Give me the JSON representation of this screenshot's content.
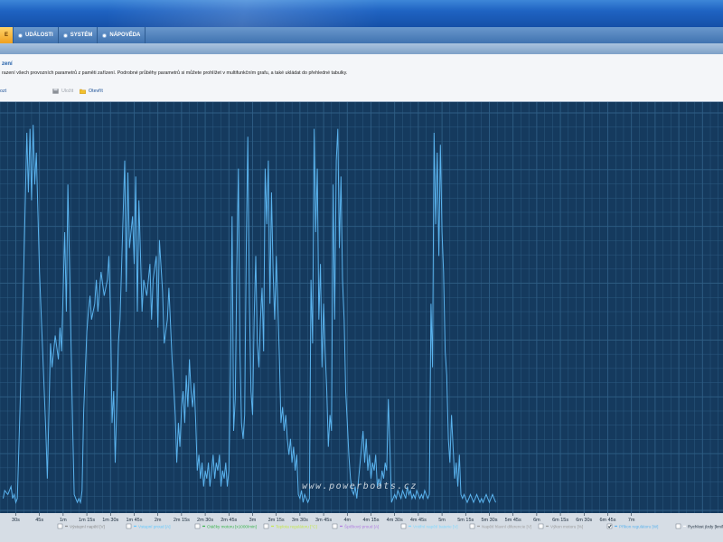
{
  "menu": {
    "items": [
      {
        "label": "E",
        "active": true
      },
      {
        "label": "UDÁLOSTI",
        "active": false
      },
      {
        "label": "SYSTÉM",
        "active": false
      },
      {
        "label": "NÁPOVĚDA",
        "active": false
      }
    ]
  },
  "info": {
    "title": "zení",
    "description": "razení všech provozních parametrů z paměti zařízení. Podrobné průběhy parametrů si můžete prohlížet v multifunkčním grafu, a také ukládat do přehledné tabulky.",
    "toolbar": {
      "left_label": "ozt",
      "save_label": "Uložit",
      "open_label": "Otevřít"
    }
  },
  "watermark": "www.powerboats.cz",
  "colors": {
    "chart_bg": "#153a5e",
    "grid": "#2f5f86",
    "line": "#5ab3ee",
    "axis_text": "#e8eef6"
  },
  "chart_data": {
    "type": "line",
    "x_unit": "s",
    "xlim": [
      20,
      478
    ],
    "ylim": [
      0,
      100
    ],
    "grid": true,
    "x_ticks": [
      {
        "label": "30s",
        "x": 30
      },
      {
        "label": "45s",
        "x": 45
      },
      {
        "label": "1m",
        "x": 60
      },
      {
        "label": "1m 15s",
        "x": 75
      },
      {
        "label": "1m 30s",
        "x": 90
      },
      {
        "label": "1m 45s",
        "x": 105
      },
      {
        "label": "2m",
        "x": 120
      },
      {
        "label": "2m 15s",
        "x": 135
      },
      {
        "label": "2m 30s",
        "x": 150
      },
      {
        "label": "2m 45s",
        "x": 165
      },
      {
        "label": "3m",
        "x": 180
      },
      {
        "label": "3m 15s",
        "x": 195
      },
      {
        "label": "3m 30s",
        "x": 210
      },
      {
        "label": "3m 45s",
        "x": 225
      },
      {
        "label": "4m",
        "x": 240
      },
      {
        "label": "4m 15s",
        "x": 255
      },
      {
        "label": "4m 30s",
        "x": 270
      },
      {
        "label": "4m 45s",
        "x": 285
      },
      {
        "label": "5m",
        "x": 300
      },
      {
        "label": "5m 15s",
        "x": 315
      },
      {
        "label": "5m 30s",
        "x": 330
      },
      {
        "label": "5m 45s",
        "x": 345
      },
      {
        "label": "6m",
        "x": 360
      },
      {
        "label": "6m 15s",
        "x": 375
      },
      {
        "label": "6m 30s",
        "x": 390
      },
      {
        "label": "6m 45s",
        "x": 405
      },
      {
        "label": "7m",
        "x": 420
      }
    ],
    "legend": [
      {
        "name": "Výstupní napětí [V]",
        "color": "#8a8a8a",
        "checked": false
      },
      {
        "name": "Vstupní proud [A]",
        "color": "#5ec8ff",
        "checked": false
      },
      {
        "name": "Otáčky motoru [x1000/min]",
        "color": "#39b54a",
        "checked": false
      },
      {
        "name": "Teplota regulátoru [°C]",
        "color": "#c4e84a",
        "checked": false
      },
      {
        "name": "Špičkový proud [A]",
        "color": "#b07ae0",
        "checked": false
      },
      {
        "name": "Vnitřní napětí baterie [V]",
        "color": "#7fd8ff",
        "checked": false
      },
      {
        "name": "Napětí hlavní diferencie [V]",
        "color": "#a0a0a0",
        "checked": false
      },
      {
        "name": "Výkon motoru [%]",
        "color": "#9a9a9a",
        "checked": false
      },
      {
        "name": "Příkon regulátoru [W]",
        "color": "#5ab3ee",
        "checked": true
      },
      {
        "name": "Rychlost jízdy [km/h]",
        "color": "#ffffff",
        "checked": false
      }
    ],
    "series": [
      {
        "values": [
          [
            22,
            3
          ],
          [
            23,
            5
          ],
          [
            25,
            4
          ],
          [
            27,
            6
          ],
          [
            28,
            3
          ],
          [
            29,
            4
          ],
          [
            30,
            2
          ],
          [
            31,
            3
          ],
          [
            33,
            30
          ],
          [
            35,
            60
          ],
          [
            37,
            95
          ],
          [
            38,
            80
          ],
          [
            39,
            96
          ],
          [
            40,
            78
          ],
          [
            41,
            97
          ],
          [
            42,
            82
          ],
          [
            43,
            90
          ],
          [
            45,
            60
          ],
          [
            47,
            40
          ],
          [
            49,
            20
          ],
          [
            50,
            8
          ],
          [
            52,
            42
          ],
          [
            53,
            36
          ],
          [
            55,
            44
          ],
          [
            57,
            38
          ],
          [
            58,
            46
          ],
          [
            59,
            40
          ],
          [
            61,
            70
          ],
          [
            62,
            50
          ],
          [
            63,
            82
          ],
          [
            64,
            62
          ],
          [
            65,
            42
          ],
          [
            66,
            22
          ],
          [
            67,
            4
          ],
          [
            68,
            3
          ],
          [
            69,
            2
          ],
          [
            70,
            3
          ],
          [
            71,
            2
          ],
          [
            72,
            5
          ],
          [
            73,
            25
          ],
          [
            75,
            45
          ],
          [
            76,
            50
          ],
          [
            77,
            54
          ],
          [
            78,
            48
          ],
          [
            80,
            52
          ],
          [
            81,
            58
          ],
          [
            82,
            50
          ],
          [
            84,
            60
          ],
          [
            86,
            54
          ],
          [
            88,
            58
          ],
          [
            89,
            64
          ],
          [
            90,
            50
          ],
          [
            91,
            22
          ],
          [
            92,
            30
          ],
          [
            93,
            12
          ],
          [
            95,
            42
          ],
          [
            96,
            48
          ],
          [
            98,
            74
          ],
          [
            99,
            88
          ],
          [
            100,
            55
          ],
          [
            101,
            85
          ],
          [
            102,
            66
          ],
          [
            104,
            74
          ],
          [
            105,
            62
          ],
          [
            106,
            84
          ],
          [
            107,
            50
          ],
          [
            108,
            78
          ],
          [
            109,
            64
          ],
          [
            110,
            50
          ],
          [
            111,
            58
          ],
          [
            113,
            54
          ],
          [
            115,
            62
          ],
          [
            116,
            48
          ],
          [
            117,
            58
          ],
          [
            119,
            64
          ],
          [
            120,
            46
          ],
          [
            121,
            68
          ],
          [
            123,
            55
          ],
          [
            124,
            42
          ],
          [
            126,
            48
          ],
          [
            127,
            56
          ],
          [
            129,
            38
          ],
          [
            130,
            32
          ],
          [
            131,
            24
          ],
          [
            132,
            12
          ],
          [
            133,
            22
          ],
          [
            134,
            16
          ],
          [
            135,
            26
          ],
          [
            136,
            30
          ],
          [
            137,
            22
          ],
          [
            138,
            34
          ],
          [
            139,
            26
          ],
          [
            140,
            38
          ],
          [
            141,
            30
          ],
          [
            142,
            26
          ],
          [
            143,
            32
          ],
          [
            144,
            22
          ],
          [
            145,
            10
          ],
          [
            146,
            14
          ],
          [
            147,
            8
          ],
          [
            148,
            12
          ],
          [
            149,
            6
          ],
          [
            150,
            10
          ],
          [
            151,
            8
          ],
          [
            152,
            12
          ],
          [
            153,
            6
          ],
          [
            154,
            10
          ],
          [
            155,
            14
          ],
          [
            156,
            8
          ],
          [
            157,
            12
          ],
          [
            158,
            10
          ],
          [
            159,
            14
          ],
          [
            160,
            6
          ],
          [
            161,
            10
          ],
          [
            162,
            8
          ],
          [
            163,
            12
          ],
          [
            164,
            6
          ],
          [
            165,
            10
          ],
          [
            166,
            34
          ],
          [
            167,
            74
          ],
          [
            168,
            20
          ],
          [
            169,
            28
          ],
          [
            170,
            60
          ],
          [
            171,
            86
          ],
          [
            172,
            40
          ],
          [
            173,
            22
          ],
          [
            174,
            18
          ],
          [
            175,
            24
          ],
          [
            176,
            66
          ],
          [
            177,
            94
          ],
          [
            178,
            52
          ],
          [
            179,
            30
          ],
          [
            180,
            24
          ],
          [
            181,
            48
          ],
          [
            182,
            64
          ],
          [
            183,
            42
          ],
          [
            184,
            36
          ],
          [
            185,
            48
          ],
          [
            186,
            56
          ],
          [
            187,
            40
          ],
          [
            188,
            86
          ],
          [
            189,
            72
          ],
          [
            190,
            88
          ],
          [
            191,
            52
          ],
          [
            192,
            80
          ],
          [
            193,
            60
          ],
          [
            194,
            48
          ],
          [
            195,
            64
          ],
          [
            196,
            52
          ],
          [
            197,
            38
          ],
          [
            198,
            22
          ],
          [
            199,
            26
          ],
          [
            200,
            20
          ],
          [
            201,
            24
          ],
          [
            202,
            18
          ],
          [
            203,
            14
          ],
          [
            204,
            18
          ],
          [
            205,
            12
          ],
          [
            206,
            16
          ],
          [
            207,
            10
          ],
          [
            208,
            14
          ],
          [
            209,
            4
          ],
          [
            210,
            3
          ],
          [
            211,
            5
          ],
          [
            212,
            2
          ],
          [
            213,
            4
          ],
          [
            214,
            3
          ],
          [
            215,
            2
          ],
          [
            216,
            3
          ],
          [
            217,
            58
          ],
          [
            218,
            42
          ],
          [
            219,
            96
          ],
          [
            220,
            70
          ],
          [
            221,
            86
          ],
          [
            222,
            48
          ],
          [
            223,
            62
          ],
          [
            224,
            36
          ],
          [
            225,
            52
          ],
          [
            226,
            40
          ],
          [
            227,
            30
          ],
          [
            228,
            16
          ],
          [
            229,
            24
          ],
          [
            230,
            20
          ],
          [
            231,
            82
          ],
          [
            232,
            48
          ],
          [
            233,
            88
          ],
          [
            234,
            96
          ],
          [
            235,
            66
          ],
          [
            236,
            84
          ],
          [
            237,
            58
          ],
          [
            238,
            48
          ],
          [
            239,
            30
          ],
          [
            240,
            22
          ],
          [
            241,
            14
          ],
          [
            242,
            8
          ],
          [
            243,
            5
          ],
          [
            244,
            4
          ],
          [
            245,
            6
          ],
          [
            246,
            3
          ],
          [
            250,
            20
          ],
          [
            251,
            12
          ],
          [
            252,
            18
          ],
          [
            253,
            10
          ],
          [
            254,
            14
          ],
          [
            255,
            8
          ],
          [
            256,
            12
          ],
          [
            257,
            10
          ],
          [
            258,
            14
          ],
          [
            259,
            6
          ],
          [
            260,
            8
          ],
          [
            261,
            6
          ],
          [
            262,
            10
          ],
          [
            263,
            8
          ],
          [
            264,
            12
          ],
          [
            265,
            10
          ],
          [
            266,
            28
          ],
          [
            267,
            16
          ],
          [
            268,
            2
          ],
          [
            269,
            3
          ],
          [
            270,
            4
          ],
          [
            271,
            3
          ],
          [
            272,
            5
          ],
          [
            273,
            4
          ],
          [
            274,
            3
          ],
          [
            275,
            5
          ],
          [
            276,
            4
          ],
          [
            277,
            3
          ],
          [
            278,
            6
          ],
          [
            279,
            4
          ],
          [
            280,
            5
          ],
          [
            281,
            3
          ],
          [
            282,
            4
          ],
          [
            283,
            3
          ],
          [
            284,
            5
          ],
          [
            285,
            4
          ],
          [
            286,
            3
          ],
          [
            287,
            4
          ],
          [
            288,
            3
          ],
          [
            289,
            5
          ],
          [
            290,
            4
          ],
          [
            291,
            3
          ],
          [
            292,
            4
          ],
          [
            293,
            52
          ],
          [
            294,
            36
          ],
          [
            295,
            95
          ],
          [
            296,
            72
          ],
          [
            297,
            90
          ],
          [
            298,
            64
          ],
          [
            299,
            92
          ],
          [
            300,
            70
          ],
          [
            301,
            60
          ],
          [
            302,
            40
          ],
          [
            303,
            34
          ],
          [
            304,
            18
          ],
          [
            305,
            12
          ],
          [
            306,
            24
          ],
          [
            307,
            16
          ],
          [
            308,
            8
          ],
          [
            309,
            12
          ],
          [
            310,
            6
          ],
          [
            311,
            14
          ],
          [
            312,
            4
          ],
          [
            313,
            3
          ],
          [
            314,
            4
          ],
          [
            315,
            3
          ],
          [
            316,
            2
          ],
          [
            317,
            3
          ],
          [
            318,
            4
          ],
          [
            319,
            3
          ],
          [
            320,
            2
          ],
          [
            321,
            3
          ],
          [
            322,
            4
          ],
          [
            323,
            3
          ],
          [
            324,
            2
          ],
          [
            325,
            3
          ],
          [
            326,
            2
          ],
          [
            327,
            3
          ],
          [
            328,
            4
          ],
          [
            329,
            3
          ],
          [
            330,
            2
          ],
          [
            331,
            3
          ],
          [
            332,
            4
          ],
          [
            333,
            3
          ],
          [
            334,
            2
          ]
        ]
      }
    ]
  }
}
